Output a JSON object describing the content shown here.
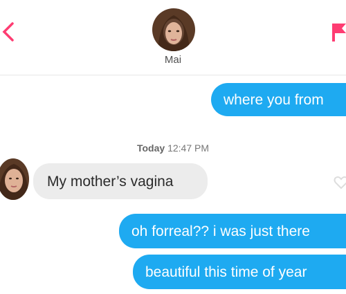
{
  "header": {
    "contact_name": "Mai",
    "back_icon": "close-x-icon",
    "report_icon": "flag-icon",
    "accent_color": "#fe3c72"
  },
  "conversation": {
    "timestamp_day": "Today",
    "timestamp_time": "12:47 PM",
    "messages": [
      {
        "direction": "sent",
        "text": "where you from"
      },
      {
        "direction": "received",
        "text": "My mother’s vagina"
      },
      {
        "direction": "sent",
        "text": "oh forreal?? i was just there"
      },
      {
        "direction": "sent",
        "text": "beautiful this time of year"
      }
    ],
    "sent_color": "#1eaaf1",
    "received_color": "#ececec"
  }
}
